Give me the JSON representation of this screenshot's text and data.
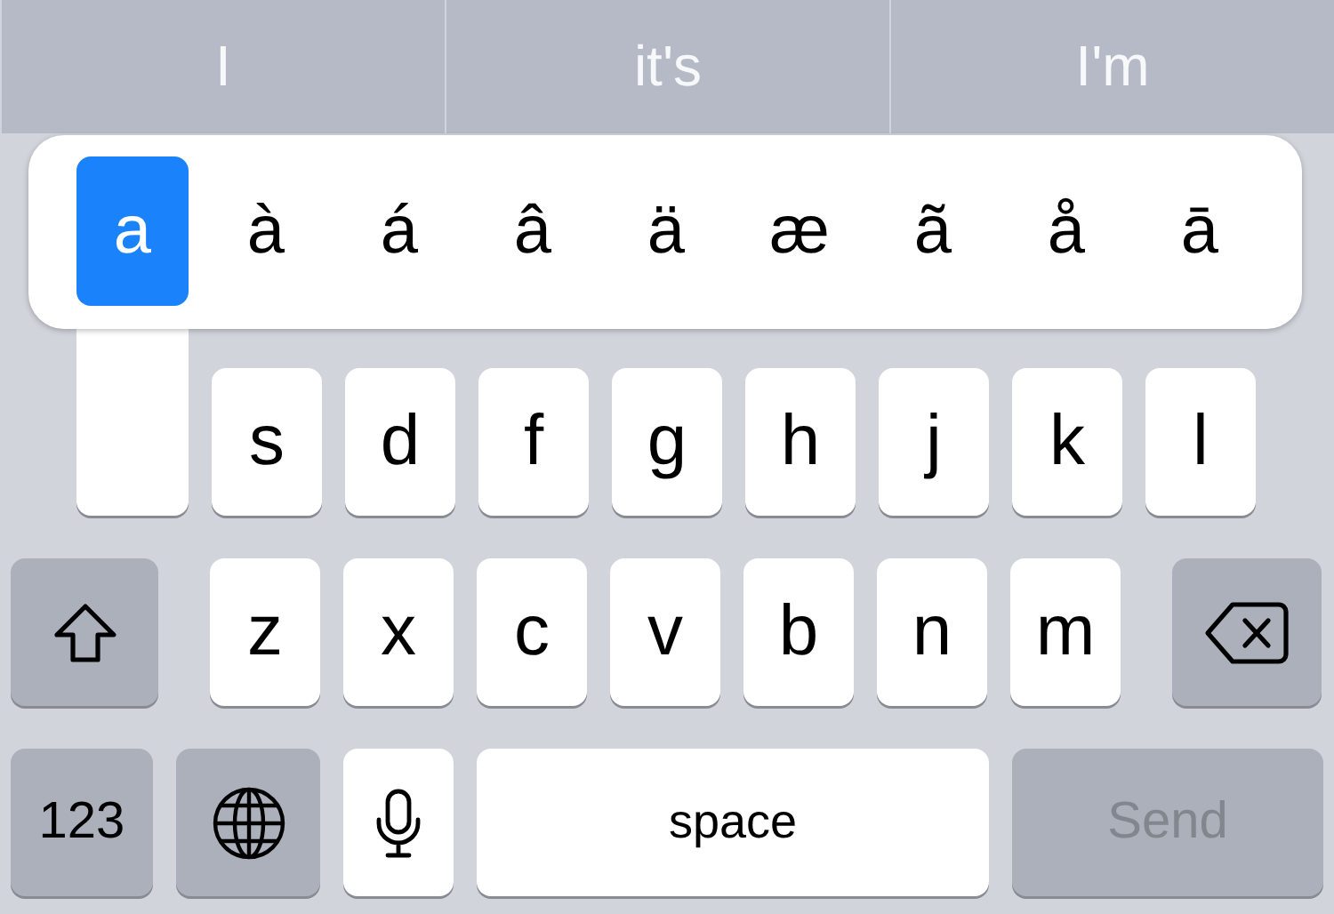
{
  "suggestions": [
    {
      "text": "I"
    },
    {
      "text": "it's"
    },
    {
      "text": "I'm"
    }
  ],
  "accent_popup": {
    "options": [
      {
        "label": "a",
        "selected": true
      },
      {
        "label": "à",
        "selected": false
      },
      {
        "label": "á",
        "selected": false
      },
      {
        "label": "â",
        "selected": false
      },
      {
        "label": "ä",
        "selected": false
      },
      {
        "label": "æ",
        "selected": false
      },
      {
        "label": "ã",
        "selected": false
      },
      {
        "label": "å",
        "selected": false
      },
      {
        "label": "ā",
        "selected": false
      }
    ]
  },
  "keyboard": {
    "rows": [
      {
        "keys": [
          {
            "kind": "pressed"
          },
          {
            "kind": "letter",
            "label": "s"
          },
          {
            "kind": "letter",
            "label": "d"
          },
          {
            "kind": "letter",
            "label": "f"
          },
          {
            "kind": "letter",
            "label": "g"
          },
          {
            "kind": "letter",
            "label": "h"
          },
          {
            "kind": "letter",
            "label": "j"
          },
          {
            "kind": "letter",
            "label": "k"
          },
          {
            "kind": "letter",
            "label": "l"
          }
        ]
      },
      {
        "keys": [
          {
            "kind": "shift"
          },
          {
            "kind": "letter",
            "label": "z"
          },
          {
            "kind": "letter",
            "label": "x"
          },
          {
            "kind": "letter",
            "label": "c"
          },
          {
            "kind": "letter",
            "label": "v"
          },
          {
            "kind": "letter",
            "label": "b"
          },
          {
            "kind": "letter",
            "label": "n"
          },
          {
            "kind": "letter",
            "label": "m"
          },
          {
            "kind": "delete"
          }
        ]
      },
      {
        "keys": [
          {
            "kind": "mode",
            "label": "123"
          },
          {
            "kind": "globe"
          },
          {
            "kind": "mic"
          },
          {
            "kind": "space",
            "label": "space"
          },
          {
            "kind": "return",
            "label": "Send",
            "disabled": true
          }
        ]
      }
    ]
  }
}
